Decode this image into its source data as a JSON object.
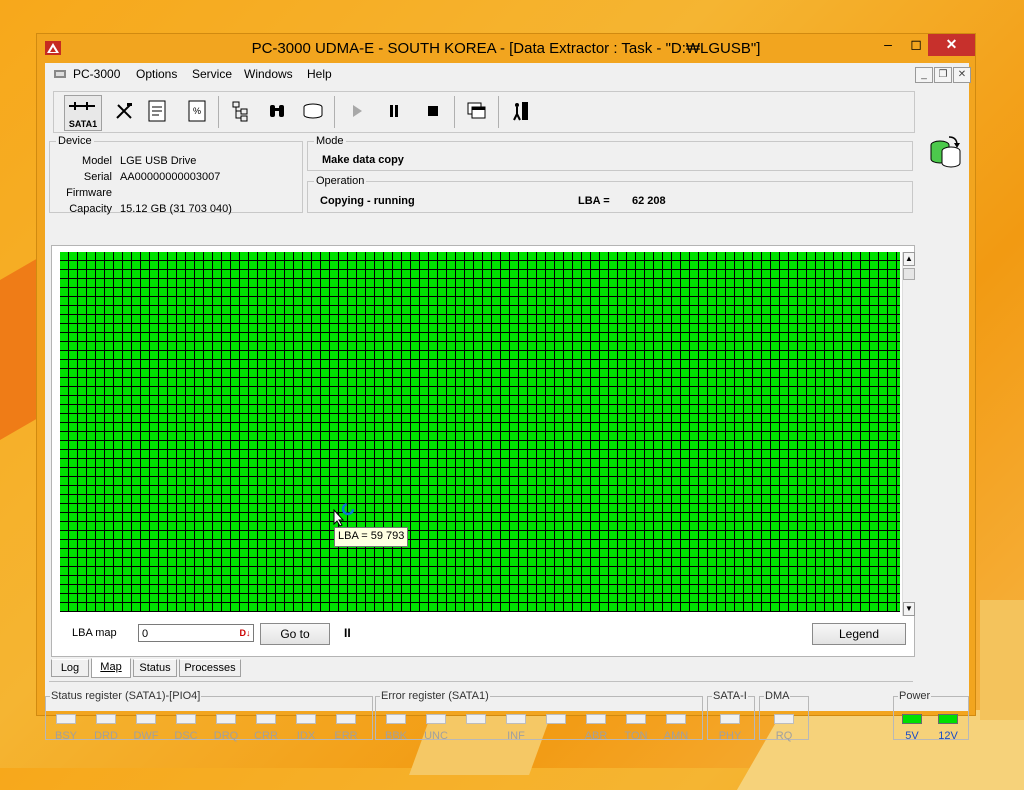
{
  "window": {
    "title": "PC-3000 UDMA-E - SOUTH KOREA - [Data Extractor : Task - \"D:₩LGUSB\"]",
    "min": "‒",
    "max": "◻",
    "close": "✕"
  },
  "menu": {
    "items": [
      "PC-3000",
      "Options",
      "Service",
      "Windows",
      "Help"
    ],
    "mdi": [
      "_",
      "❐",
      "✕"
    ]
  },
  "toolbar": {
    "sata_label": "SATA1"
  },
  "device": {
    "legend": "Device",
    "rows": [
      {
        "key": "Model",
        "value": "LGE USB Drive"
      },
      {
        "key": "Serial",
        "value": "AA00000000003007"
      },
      {
        "key": "Firmware",
        "value": ""
      },
      {
        "key": "Capacity",
        "value": "15.12 GB (31 703 040)"
      }
    ]
  },
  "mode": {
    "legend": "Mode",
    "value": "Make data copy"
  },
  "operation": {
    "legend": "Operation",
    "status": "Copying - running",
    "lba_label": "LBA =",
    "lba_value": "62 208"
  },
  "map": {
    "scroll_up": "▲",
    "scroll_down": "▼",
    "tooltip": "LBA =   59 793",
    "lba_map_label": "LBA map",
    "lba_map_value": "0",
    "goto_label": "Go to",
    "pause_label": "II",
    "legend_label": "Legend"
  },
  "tabs": [
    "Log",
    "Map",
    "Status",
    "Processes"
  ],
  "status_register": {
    "legend": "Status register (SATA1)-[PIO4]",
    "leds": [
      "BSY",
      "DRD",
      "DWF",
      "DSC",
      "DRQ",
      "CRR",
      "IDX",
      "ERR"
    ]
  },
  "error_register": {
    "legend": "Error register (SATA1)",
    "leds": [
      "BBK",
      "UNC",
      "",
      "INF",
      "",
      "ABR",
      "TON",
      "AMN"
    ]
  },
  "sata_i": {
    "legend": "SATA-I",
    "leds": [
      "PHY"
    ]
  },
  "dma": {
    "legend": "DMA",
    "leds": [
      "RQ"
    ]
  },
  "power": {
    "legend": "Power",
    "leds": [
      "5V",
      "12V"
    ]
  },
  "colors": {
    "map_good": "#00e000",
    "close_red": "#c7302c",
    "power_on": "#00e000"
  }
}
